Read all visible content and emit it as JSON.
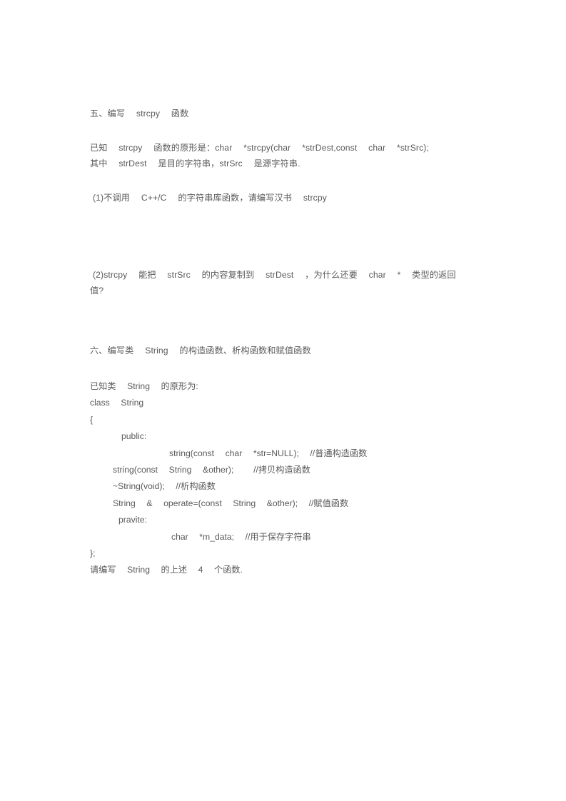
{
  "document": {
    "background_color": "#ffffff",
    "text_color": "#5a5a5a",
    "sections": {
      "five": {
        "heading": "五、编写　 strcpy　 函数",
        "known_line1": "已知　 strcpy　 函数的原形是：char　 *strcpy(char　 *strDest,const　 char　 *strSrc);",
        "known_line2": "其中　 strDest　 是目的字符串，strSrc　 是源字符串.",
        "question1": "(1)不调用　 C++/C　 的字符串库函数，请编写汉书　 strcpy",
        "question2_line1": "(2)strcpy　 能把　 strSrc　 的内容复制到　 strDest　 ，为什么还要　 char　 *　 类型的返回",
        "question2_line2": "值?"
      },
      "six": {
        "heading": "六、编写类　 String　 的构造函数、析构函数和赋值函数",
        "code": [
          {
            "indent": 0,
            "text": "已知类　 String　 的原形为:"
          },
          {
            "indent": 0,
            "text": "class　 String"
          },
          {
            "indent": 0,
            "text": "{"
          },
          {
            "indent": 3,
            "text": "public:"
          },
          {
            "indent": 4,
            "text": "string(const　 char　 *str=NULL);　 //普通构造函数"
          },
          {
            "indent": 1,
            "text": "string(const　 String　 &other);　　 //拷贝构造函数"
          },
          {
            "indent": 1,
            "text": "~String(void);　 //析构函数"
          },
          {
            "indent": 1,
            "text": "String　 &　 operate=(const　 String　 &other);　 //赋值函数"
          },
          {
            "indent": 2,
            "text": "pravite:"
          },
          {
            "indent": 5,
            "text": "char　 *m_data;　 //用于保存字符串"
          },
          {
            "indent": 0,
            "text": "};"
          },
          {
            "indent": 0,
            "text": "请编写　 String　 的上述　 4　 个函数."
          }
        ]
      }
    }
  }
}
